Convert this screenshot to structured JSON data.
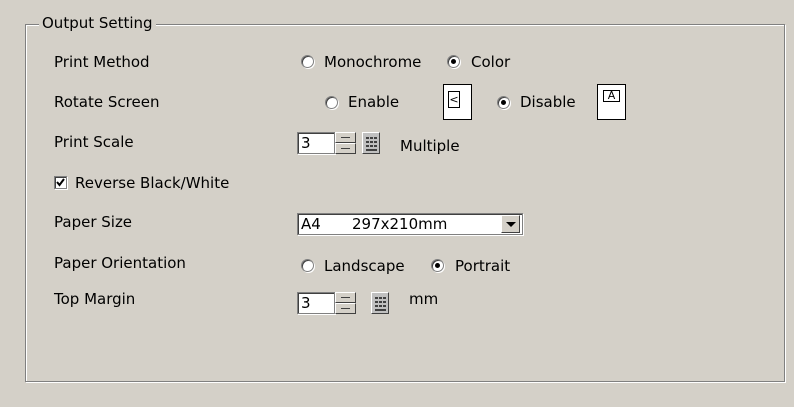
{
  "group": {
    "title": "Output Setting"
  },
  "print_method": {
    "label": "Print Method",
    "options": [
      {
        "label": "Monochrome",
        "selected": false
      },
      {
        "label": "Color",
        "selected": true
      }
    ]
  },
  "rotate_screen": {
    "label": "Rotate Screen",
    "options": [
      {
        "label": "Enable",
        "selected": false,
        "preview_glyph": "<"
      },
      {
        "label": "Disable",
        "selected": true,
        "preview_glyph": "A"
      }
    ]
  },
  "print_scale": {
    "label": "Print Scale",
    "value": "3",
    "unit": "Multiple"
  },
  "reverse_bw": {
    "label": "Reverse Black/White",
    "checked": true
  },
  "paper_size": {
    "label": "Paper Size",
    "value": "A4",
    "dimensions": "297x210mm"
  },
  "paper_orientation": {
    "label": "Paper Orientation",
    "options": [
      {
        "label": "Landscape",
        "selected": false
      },
      {
        "label": "Portrait",
        "selected": true
      }
    ]
  },
  "top_margin": {
    "label": "Top Margin",
    "value": "3",
    "unit": "mm"
  }
}
